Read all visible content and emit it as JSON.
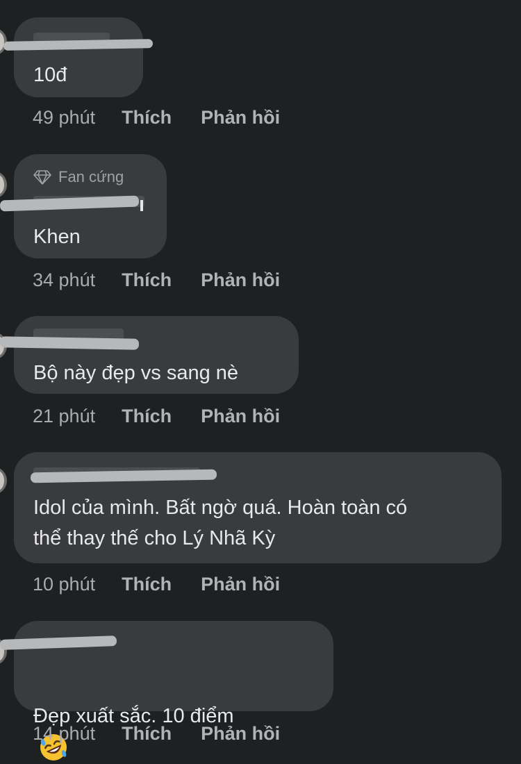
{
  "comments": [
    {
      "text": "10đ",
      "time": "49 phút",
      "like_label": "Thích",
      "reply_label": "Phản hồi"
    },
    {
      "badge": "Fan cứng",
      "text": "Khen",
      "time": "34 phút",
      "like_label": "Thích",
      "reply_label": "Phản hồi"
    },
    {
      "text": "Bộ này đẹp vs sang nè",
      "time": "21 phút",
      "like_label": "Thích",
      "reply_label": "Phản hồi"
    },
    {
      "text": "Idol của mình. Bất ngờ quá. Hoàn toàn có\nthể thay thế cho Lý Nhã Kỳ",
      "time": "10 phút",
      "like_label": "Thích",
      "reply_label": "Phản hồi"
    },
    {
      "text": "Đẹp xuất sắc. 10 điểm",
      "emoji": "rolling-on-floor-laughing-emoji",
      "time": "14 phút",
      "like_label": "Thích",
      "reply_label": "Phản hồi"
    }
  ],
  "colors": {
    "background": "#1f2022",
    "bubble": "#3a3b3c",
    "text": "#e8e9ec",
    "meta": "#b0b3b8",
    "redaction": "#b7b8ba"
  }
}
